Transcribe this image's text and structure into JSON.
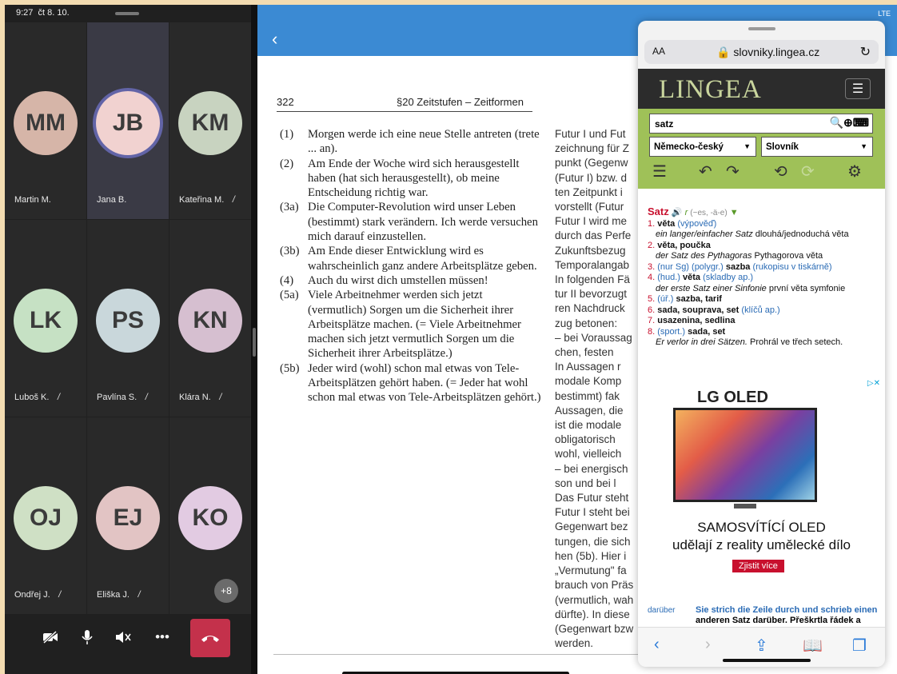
{
  "teams": {
    "time": "9:27",
    "date": "čt 8. 10.",
    "participants": [
      {
        "initials": "MM",
        "name": "Martin M.",
        "muted": false,
        "color": "#d6b5a8",
        "active": false
      },
      {
        "initials": "JB",
        "name": "Jana B.",
        "muted": false,
        "color": "#f1d2d0",
        "active": true
      },
      {
        "initials": "KM",
        "name": "Kateřina M.",
        "muted": true,
        "color": "#c8d3c0",
        "active": false
      },
      {
        "initials": "LK",
        "name": "Luboš K.",
        "muted": true,
        "color": "#c6e1c4",
        "active": false
      },
      {
        "initials": "PS",
        "name": "Pavlína S.",
        "muted": true,
        "color": "#c9d7db",
        "active": false
      },
      {
        "initials": "KN",
        "name": "Klára N.",
        "muted": true,
        "color": "#d6bfd0",
        "active": false
      },
      {
        "initials": "OJ",
        "name": "Ondřej J.",
        "muted": true,
        "color": "#cfe0c5",
        "active": false
      },
      {
        "initials": "EJ",
        "name": "Eliška J.",
        "muted": true,
        "color": "#e2c4c4",
        "active": false
      },
      {
        "initials": "KO",
        "name": "",
        "muted": false,
        "color": "#e2cbe2",
        "active": false
      }
    ],
    "more_count": "+8",
    "controls": [
      {
        "icon": "camera-off-icon",
        "glyph": "✖"
      },
      {
        "icon": "mic-icon",
        "glyph": "🎙"
      },
      {
        "icon": "speaker-icon",
        "glyph": "🔊"
      },
      {
        "icon": "more-icon",
        "glyph": "•••"
      }
    ],
    "hangup_glyph": "☎"
  },
  "reader": {
    "status": "LTE",
    "page_number": "322",
    "section": "§20 Zeitstufen – Zeitformen",
    "examples": [
      {
        "num": "(1)",
        "text": "Morgen werde ich eine neue Stelle antreten (trete ... an)."
      },
      {
        "num": "(2)",
        "text": "Am Ende der Woche wird sich herausgestellt haben (hat sich herausgestellt), ob meine Entscheidung richtig war."
      },
      {
        "num": "(3a)",
        "text": "Die Computer-Revolution wird unser Leben (bestimmt) stark verändern. Ich werde versuchen mich darauf einzustellen."
      },
      {
        "num": "(3b)",
        "text": "Am Ende dieser Entwicklung wird es wahrscheinlich ganz andere Arbeitsplätze geben."
      },
      {
        "num": "(4)",
        "text": "Auch du wirst dich umstellen müssen!"
      },
      {
        "num": "(5a)",
        "text": "Viele Arbeitnehmer werden sich jetzt (vermutlich) Sorgen um die Sicherheit ihrer Arbeitsplätze machen. (= Viele Arbeitnehmer machen sich jetzt vermutlich Sorgen um die Sicherheit ihrer Arbeitsplätze.)"
      },
      {
        "num": "(5b)",
        "text": "Jeder wird (wohl) schon mal etwas von Tele-Arbeitsplätzen gehört haben. (= Jeder hat wohl schon mal etwas von Tele-Arbeitsplätzen gehört.)"
      }
    ],
    "column2": [
      "Futur I und Fut",
      "zeichnung für Z",
      "punkt (Gegenw",
      "(Futur I) bzw. d",
      "ten Zeitpunkt i",
      "vorstellt (Futur",
      "Futur I wird me",
      "durch das Perfe",
      "Zukunftsbezug",
      "Temporalangab",
      "In folgenden Fä",
      "tur II bevorzugt",
      "ren Nachdruck",
      "zug betonen:",
      "– bei Voraussag",
      "chen, festen",
      "In Aussagen r",
      "modale Komp",
      "bestimmt) fak",
      "Aussagen, die",
      "ist die modale",
      "obligatorisch",
      "wohl, vielleich",
      "– bei energisch",
      "son und bei l",
      "Das Futur steht",
      "Futur I steht bei",
      "Gegenwart bez",
      "tungen, die sich",
      "hen (5b). Hier i",
      "„Vermutung\" fa",
      "brauch von Präs",
      "(vermutlich, wah",
      "dürfte). In diese",
      "(Gegenwart bzw",
      "werden."
    ]
  },
  "safari": {
    "aa_label": "AA",
    "url": "slovniky.lingea.cz",
    "logo": "LINGEA",
    "search_value": "satz",
    "dictionary_select": "Německo-český",
    "type_select": "Slovník",
    "entry": {
      "headword": "Satz",
      "gender": "r",
      "grammar": "(~es, -ä-e)",
      "senses": [
        {
          "n": "1.",
          "tr": "věta",
          "gloss": "(výpověď)"
        },
        {
          "n": "",
          "ex": "ein langer/einfacher Satz",
          "extr": "dlouhá/jednoduchá věta"
        },
        {
          "n": "2.",
          "tr": "věta, poučka"
        },
        {
          "n": "",
          "ex": "der Satz des Pythagoras",
          "extr": "Pythagorova věta"
        },
        {
          "n": "3.",
          "pre": "(nur Sg) (polygr.)",
          "tr": "sazba",
          "gloss": "(rukopisu v tiskárně)"
        },
        {
          "n": "4.",
          "pre": "(hud.)",
          "tr": "věta",
          "gloss": "(skladby ap.)"
        },
        {
          "n": "",
          "ex": "der erste Satz einer Sinfonie",
          "extr": "první věta symfonie"
        },
        {
          "n": "5.",
          "pre": "(úř.)",
          "tr": "sazba, tarif"
        },
        {
          "n": "6.",
          "tr": "sada, souprava, set",
          "gloss": "(klíčů ap.)"
        },
        {
          "n": "7.",
          "tr": "usazenina, sedlina"
        },
        {
          "n": "8.",
          "pre": "(sport.)",
          "tr": "sada, set"
        },
        {
          "n": "",
          "ex": "Er verlor in drei Sätzen.",
          "extr": "Prohrál ve třech setech."
        }
      ]
    },
    "ad": {
      "brand": "LG OLED",
      "line1": "SAMOSVÍTÍCÍ OLED",
      "line2": "udělají z reality umělecké dílo",
      "cta": "Zjistit více"
    },
    "related": {
      "keyword": "darüber",
      "line1": "Sie strich die Zeile durch und schrieb einen",
      "line2": "anderen Satz darüber. Přeškrtla řádek a"
    }
  }
}
